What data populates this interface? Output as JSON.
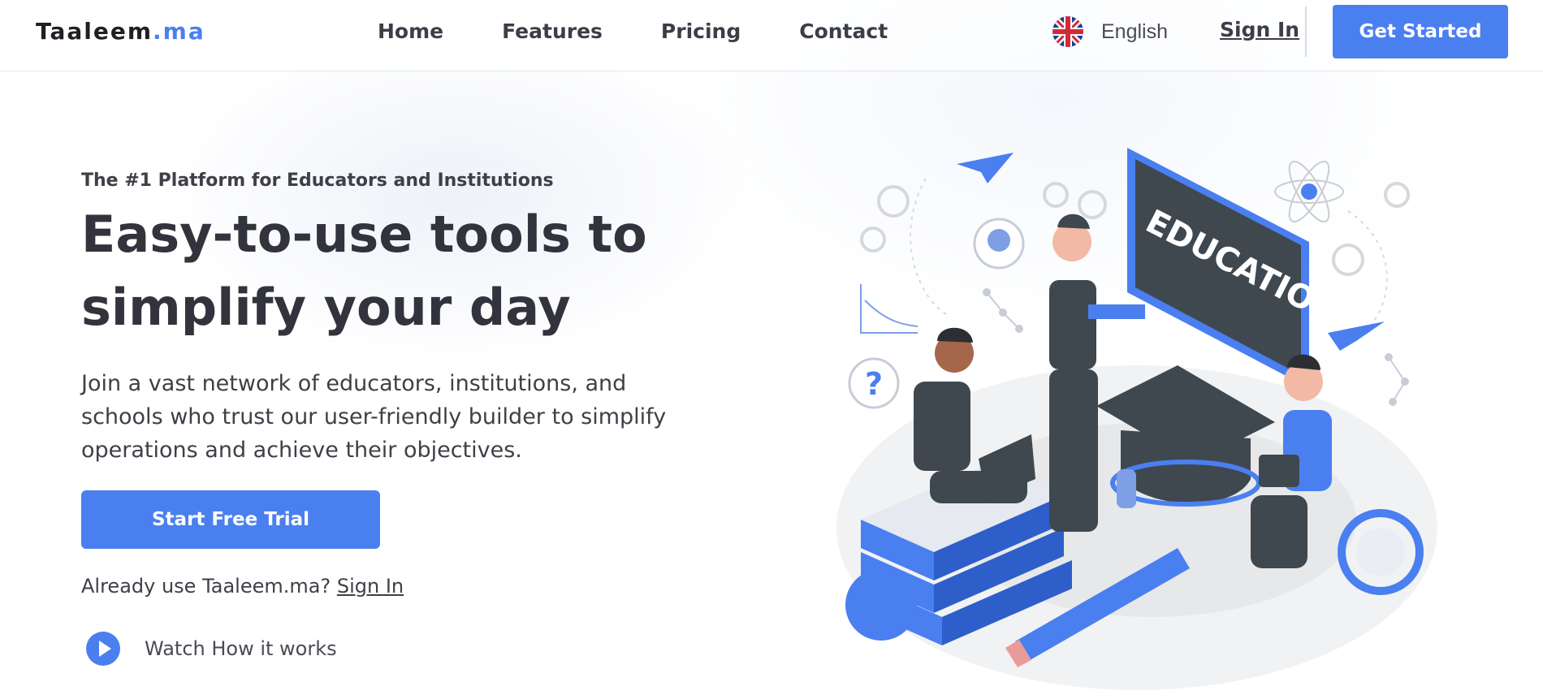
{
  "header": {
    "logo_main": "Taaleem",
    "logo_accent": ".ma",
    "nav": [
      "Home",
      "Features",
      "Pricing",
      "Contact"
    ],
    "language": "English",
    "flag_icon": "uk-flag-icon",
    "sign_in": "Sign In",
    "cta": "Get Started"
  },
  "hero": {
    "eyebrow": "The #1 Platform for Educators and Institutions",
    "headline": "Easy-to-use tools to simplify your day",
    "description": "Join a vast network of educators, institutions, and schools who trust our user-friendly builder to simplify operations and achieve their objectives.",
    "trial_button": "Start Free Trial",
    "already_text": "Already use Taaleem.ma?",
    "already_link": "Sign In",
    "watch_label": "Watch How it works",
    "play_icon": "play-icon"
  },
  "illustration": {
    "board_text": "EDUCATION",
    "question_mark": "?"
  },
  "colors": {
    "accent": "#4a7ff0",
    "text_dark": "#33333d",
    "slate": "#3f474f"
  }
}
